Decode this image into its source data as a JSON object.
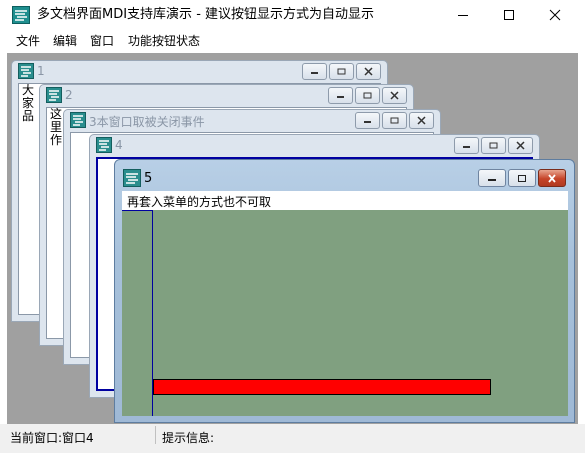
{
  "app": {
    "title": "多文档界面MDI支持库演示 - 建议按钮显示方式为自动显示",
    "icon": "app-logo-icon"
  },
  "menubar": {
    "items": [
      "文件",
      "编辑",
      "窗口",
      "功能按钮状态"
    ]
  },
  "children": {
    "w1": {
      "title": "1",
      "partial_text": "大家品"
    },
    "w2": {
      "title": "2",
      "partial_text": "这里作"
    },
    "w3": {
      "title": "3本窗口取被关闭事件"
    },
    "w4": {
      "title": "4"
    },
    "w5": {
      "title": "5",
      "menu_label": "再套入菜单的方式也不可取"
    }
  },
  "status": {
    "left": "当前窗口:窗口4",
    "right": "提示信息:"
  },
  "colors": {
    "mdi_background": "#a0a0a0",
    "client_green": "#80a080",
    "red_bar": "#ff0000",
    "frame_blue": "#0000a0"
  }
}
